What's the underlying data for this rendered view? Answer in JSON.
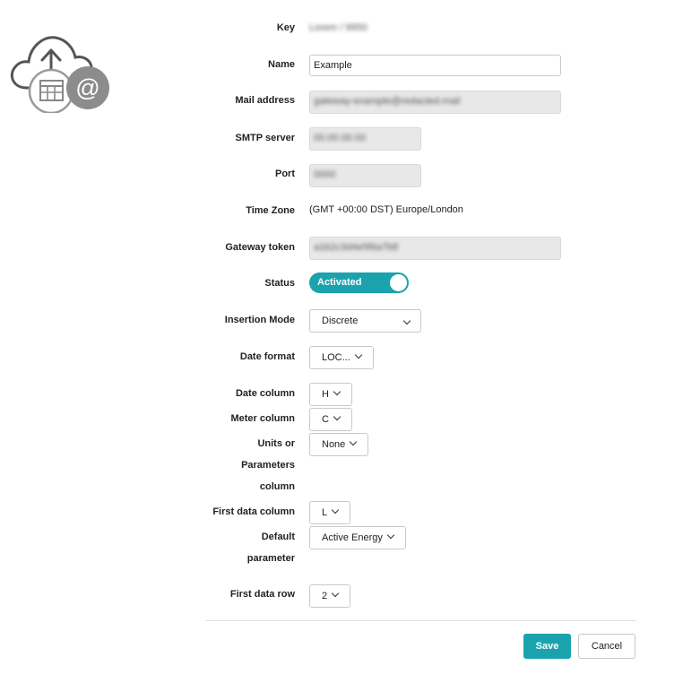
{
  "logo": {
    "icon": "cloud-upload-calendar-email-icon"
  },
  "form": {
    "key": {
      "label": "Key",
      "value": "Lorem / 9950"
    },
    "name": {
      "label": "Name",
      "value": "Example"
    },
    "mail": {
      "label": "Mail address",
      "value": "gateway-example@redacted.mail"
    },
    "smtp": {
      "label": "SMTP server",
      "value": "00.00.00.00"
    },
    "port": {
      "label": "Port",
      "value": "0000"
    },
    "timezone": {
      "label": "Time Zone",
      "value": "(GMT +00:00 DST) Europe/London"
    },
    "token": {
      "label": "Gateway token",
      "value": "a1b2c3d4e5f6a7b8"
    },
    "status": {
      "label": "Status",
      "value": "Activated",
      "enabled": true
    },
    "insertion_mode": {
      "label": "Insertion Mode",
      "value": "Discrete"
    },
    "date_format": {
      "label": "Date format",
      "value": "LOC..."
    },
    "date_column": {
      "label": "Date column",
      "value": "H"
    },
    "meter_column": {
      "label": "Meter column",
      "value": "C"
    },
    "units_column": {
      "label_lines": [
        "Units or",
        "Parameters",
        "column"
      ],
      "value": "None"
    },
    "first_data_column": {
      "label": "First data column",
      "value": "L"
    },
    "default_parameter": {
      "label_lines": [
        "Default",
        "parameter"
      ],
      "value": "Active Energy"
    },
    "first_data_row": {
      "label": "First data row",
      "value": "2"
    }
  },
  "actions": {
    "save": "Save",
    "cancel": "Cancel"
  },
  "colors": {
    "accent": "#1aa3ad",
    "readonly_bg": "#e8e8e8"
  }
}
